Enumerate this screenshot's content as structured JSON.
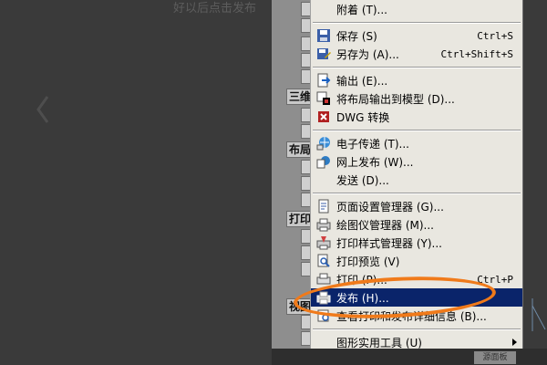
{
  "caption": "好以后点击发布",
  "menu": {
    "items": [
      {
        "label": "附着 (T)...",
        "shortcut": ""
      },
      {
        "label": "保存 (S)",
        "shortcut": "Ctrl+S"
      },
      {
        "label": "另存为 (A)...",
        "shortcut": "Ctrl+Shift+S"
      },
      {
        "label": "输出 (E)...",
        "shortcut": ""
      },
      {
        "label": "将布局输出到模型 (D)...",
        "shortcut": ""
      },
      {
        "label": "DWG 转换",
        "shortcut": ""
      },
      {
        "label": "电子传递 (T)...",
        "shortcut": ""
      },
      {
        "label": "网上发布 (W)...",
        "shortcut": ""
      },
      {
        "label": "发送 (D)...",
        "shortcut": ""
      },
      {
        "label": "页面设置管理器 (G)...",
        "shortcut": ""
      },
      {
        "label": "绘图仪管理器 (M)...",
        "shortcut": ""
      },
      {
        "label": "打印样式管理器 (Y)...",
        "shortcut": ""
      },
      {
        "label": "打印预览 (V)",
        "shortcut": ""
      },
      {
        "label": "打印 (P)...",
        "shortcut": "Ctrl+P"
      },
      {
        "label": "发布 (H)...",
        "shortcut": ""
      },
      {
        "label": "查看打印和发布详细信息 (B)...",
        "shortcut": ""
      },
      {
        "label": "图形实用工具 (U)",
        "shortcut": ""
      }
    ]
  },
  "toolbar_heads": {
    "three_d": "三维",
    "layout": "布局",
    "print": "打印",
    "view": "视图"
  },
  "status_chip": "源面板",
  "colors": {
    "highlight": "#0a246a",
    "annotation_ring": "#f07a1a",
    "menu_bg": "#e9e7e0"
  }
}
